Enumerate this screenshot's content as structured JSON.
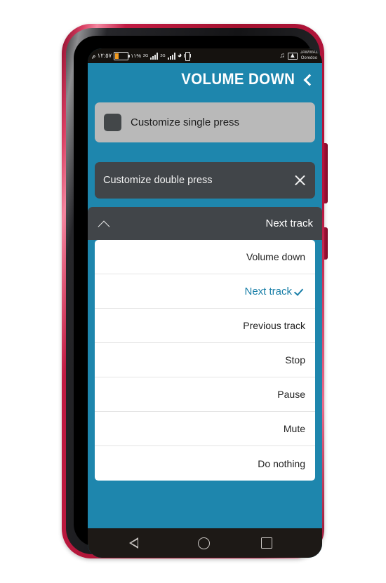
{
  "statusbar": {
    "time": "١٢:٥٧ م",
    "battery_percent": "١١%",
    "sim1_label": "2G",
    "sim2_label": "2G",
    "carrier_line1": "JAWWAL",
    "carrier_line2": "Ooredoo",
    "icons": {
      "battery": "battery-icon",
      "signal_sim1": "signal-bars-icon",
      "signal_sim2": "signal-bars-icon",
      "wifi": "wifi-icon",
      "vibrate": "vibrate-icon",
      "music": "music-note-icon",
      "image": "image-icon"
    }
  },
  "header": {
    "title": "VOLUME DOWN",
    "back_icon": "chevron-left-icon"
  },
  "single_press_card": {
    "label": "Customize single press",
    "icon": "square-block-icon"
  },
  "double_press_card": {
    "label": "Customize double press",
    "close_icon": "close-x-icon"
  },
  "dropdown": {
    "selected_value": "Next track",
    "toggle_icon": "chevron-up-icon",
    "options": [
      {
        "label": "Volume down",
        "selected": false
      },
      {
        "label": "Next track",
        "selected": true
      },
      {
        "label": "Previous track",
        "selected": false
      },
      {
        "label": "Stop",
        "selected": false
      },
      {
        "label": "Pause",
        "selected": false
      },
      {
        "label": "Mute",
        "selected": false
      },
      {
        "label": "Do nothing",
        "selected": false
      }
    ],
    "check_icon": "checkmark-icon"
  },
  "navbar": {
    "back": "back-triangle-icon",
    "home": "home-circle-icon",
    "recents": "recents-square-icon"
  },
  "colors": {
    "accent_teal": "#1e86ad",
    "selected_text": "#1a7fa8",
    "dark_card": "#414549",
    "gray_card": "#b9b9b9",
    "frame_pink": "#a3122f"
  }
}
